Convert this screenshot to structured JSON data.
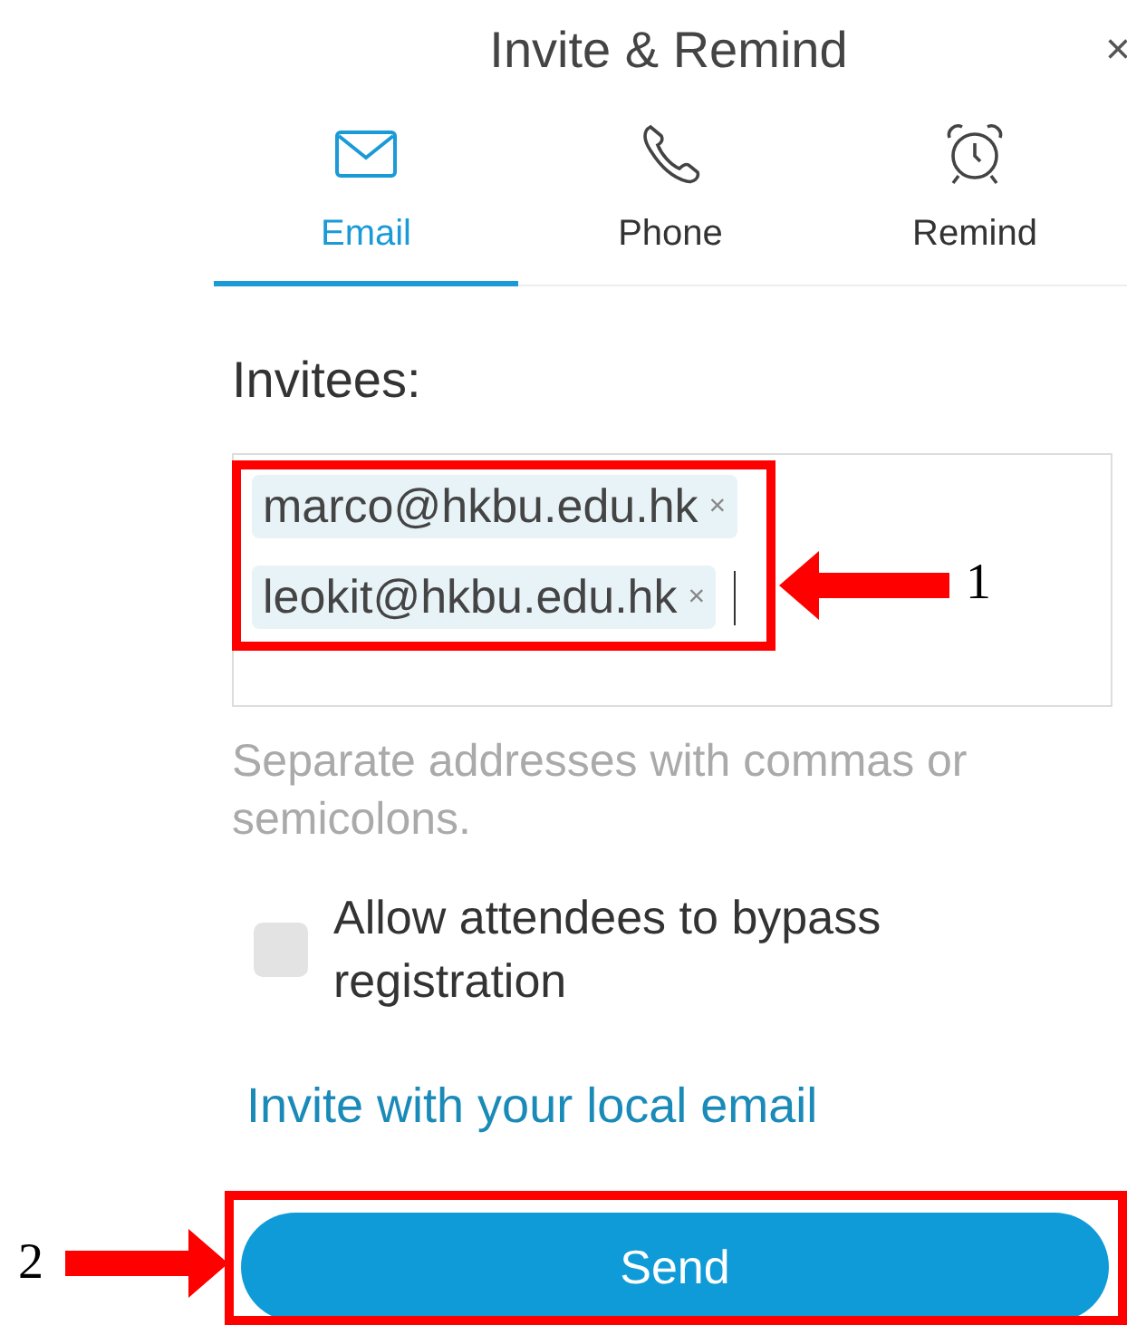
{
  "dialog": {
    "title": "Invite & Remind",
    "close": "×"
  },
  "tabs": [
    {
      "label": "Email",
      "kind": "email",
      "selected": true
    },
    {
      "label": "Phone",
      "kind": "phone",
      "selected": false
    },
    {
      "label": "Remind",
      "kind": "alarm",
      "selected": false
    }
  ],
  "invitees": {
    "label": "Invitees:",
    "chips": [
      {
        "address": "marco@hkbu.edu.hk",
        "remove": "×"
      },
      {
        "address": "leokit@hkbu.edu.hk",
        "remove": "×"
      }
    ],
    "hint": "Separate addresses with commas or semicolons."
  },
  "bypass": {
    "label": "Allow attendees to bypass registration",
    "checked": false
  },
  "link": "Invite with your local email",
  "send": "Send",
  "annotations": [
    {
      "label": "1"
    },
    {
      "label": "2"
    }
  ]
}
